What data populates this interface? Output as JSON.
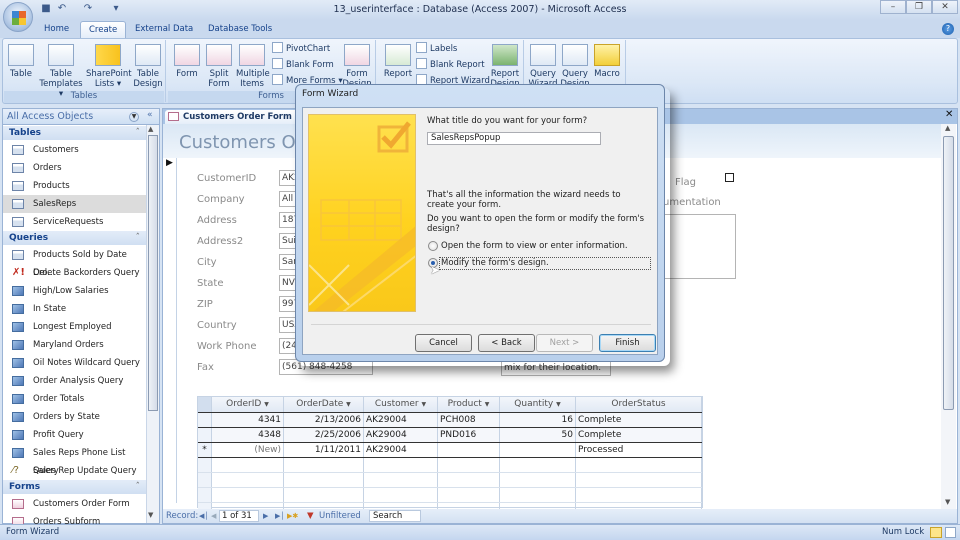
{
  "window": {
    "title": "13_userinterface : Database (Access 2007) - Microsoft Access",
    "controls": {
      "minimize": "–",
      "restore": "❐",
      "close": "✕"
    }
  },
  "quick_access": {
    "save": "💾",
    "undo": "↶",
    "redo": "↷",
    "customize": "▾"
  },
  "ribbon": {
    "tabs": [
      {
        "label": "Home",
        "active": false
      },
      {
        "label": "Create",
        "active": true
      },
      {
        "label": "External Data",
        "active": false
      },
      {
        "label": "Database Tools",
        "active": false
      }
    ],
    "groups": {
      "tables": {
        "label": "Tables",
        "buttons": [
          "Table",
          "Table Templates ▾",
          "SharePoint Lists ▾",
          "Table Design"
        ]
      },
      "forms": {
        "label": "Forms",
        "buttons": [
          "Form",
          "Split Form",
          "Multiple Items"
        ],
        "small_buttons": [
          "PivotChart",
          "Blank Form",
          "More Forms ▾"
        ],
        "design": "Form Design"
      },
      "reports": {
        "buttons": [
          "Report"
        ],
        "small_buttons": [
          "Labels",
          "Blank Report",
          "Report Wizard"
        ],
        "design": "Report Design"
      },
      "other": {
        "buttons": [
          "Query Wizard",
          "Query Design",
          "Macro"
        ]
      }
    }
  },
  "nav_pane": {
    "title": "All Access Objects",
    "collapse": "«",
    "groups": [
      {
        "label": "Tables",
        "items": [
          {
            "label": "Customers",
            "icon": "table"
          },
          {
            "label": "Orders",
            "icon": "table"
          },
          {
            "label": "Products",
            "icon": "table"
          },
          {
            "label": "SalesReps",
            "icon": "table",
            "selected": true
          },
          {
            "label": "ServiceRequests",
            "icon": "table"
          }
        ]
      },
      {
        "label": "Queries",
        "items": [
          {
            "label": "Products Sold by Date Cro...",
            "icon": "crosstab"
          },
          {
            "label": "Delete Backorders Query",
            "icon": "delete-query"
          },
          {
            "label": "High/Low Salaries",
            "icon": "query"
          },
          {
            "label": "In State",
            "icon": "query"
          },
          {
            "label": "Longest Employed",
            "icon": "query"
          },
          {
            "label": "Maryland Orders",
            "icon": "query"
          },
          {
            "label": "Oil Notes Wildcard Query",
            "icon": "query"
          },
          {
            "label": "Order Analysis Query",
            "icon": "query"
          },
          {
            "label": "Order Totals",
            "icon": "query"
          },
          {
            "label": "Orders by State",
            "icon": "query"
          },
          {
            "label": "Profit Query",
            "icon": "query"
          },
          {
            "label": "Sales Reps Phone List Query",
            "icon": "query"
          },
          {
            "label": "Sales Rep Update Query",
            "icon": "update-query"
          }
        ]
      },
      {
        "label": "Forms",
        "items": [
          {
            "label": "Customers Order Form",
            "icon": "form"
          },
          {
            "label": "Orders Subform",
            "icon": "form"
          }
        ]
      }
    ]
  },
  "document": {
    "tab": "Customers Order Form",
    "form_title": "Customers Order Form",
    "fields": [
      {
        "label": "CustomerID",
        "value": "AK29004"
      },
      {
        "label": "Company",
        "value": "All"
      },
      {
        "label": "Address",
        "value": "187"
      },
      {
        "label": "Address2",
        "value": "Sui"
      },
      {
        "label": "City",
        "value": "San"
      },
      {
        "label": "State",
        "value": "NV"
      },
      {
        "label": "ZIP",
        "value": "997"
      },
      {
        "label": "Country",
        "value": "USA"
      },
      {
        "label": "Work Phone",
        "value": "(24"
      },
      {
        "label": "Fax",
        "value": "(561) 848-4258"
      }
    ],
    "flag_label": "Flag",
    "documentation_label": "umentation",
    "notes_tail": "mix for their location.",
    "subform": {
      "columns": [
        "OrderID",
        "OrderDate",
        "Customer",
        "Product",
        "Quantity",
        "OrderStatus"
      ],
      "rows": [
        {
          "selector": "",
          "cells": [
            "4341",
            "2/13/2006",
            "AK29004",
            "PCH008",
            "16",
            "Complete"
          ]
        },
        {
          "selector": "",
          "cells": [
            "4348",
            "2/25/2006",
            "AK29004",
            "PND016",
            "50",
            "Complete"
          ]
        },
        {
          "selector": "*",
          "cells": [
            "(New)",
            "1/11/2011",
            "AK29004",
            "",
            "",
            "Processed"
          ]
        }
      ]
    },
    "record_nav": {
      "label": "Record:",
      "position": "1 of 31",
      "filter": "Unfiltered",
      "search": "Search"
    }
  },
  "dialog": {
    "title": "Form Wizard",
    "question": "What title do you want for your form?",
    "title_value": "SalesRepsPopup",
    "info": "That's all the information the wizard needs to create your form.",
    "open_or_modify": "Do you want to open the form or modify the form's design?",
    "options": [
      {
        "label": "Open the form to view or enter information.",
        "selected": false
      },
      {
        "label": "Modify the form's design.",
        "selected": true
      }
    ],
    "buttons": {
      "cancel": "Cancel",
      "back": "< Back",
      "next": "Next >",
      "finish": "Finish"
    }
  },
  "status_bar": {
    "left": "Form Wizard",
    "num_lock": "Num Lock"
  }
}
